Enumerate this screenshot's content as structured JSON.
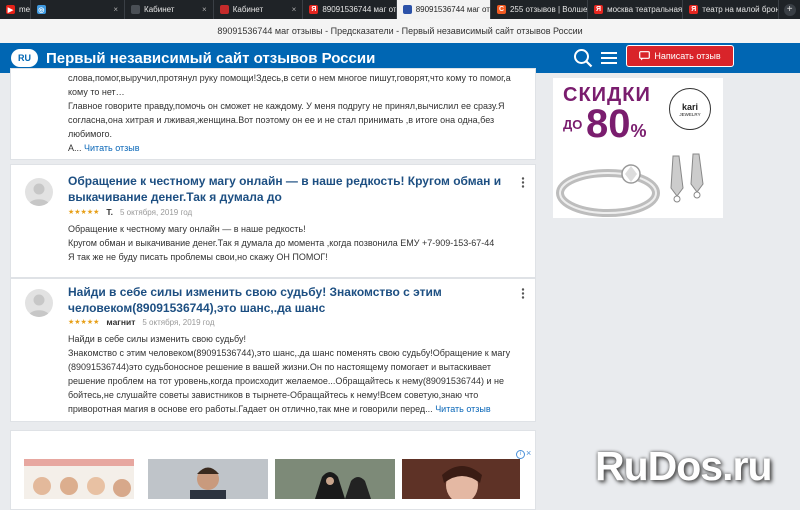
{
  "browser": {
    "tabs": [
      {
        "title": "me",
        "favicon": "youtube-icon",
        "color": "#e62117",
        "glyph": "▶",
        "active": false
      },
      {
        "title": "",
        "favicon": "opera-sync-icon",
        "color": "#3f9ae1",
        "glyph": "◎",
        "active": false
      },
      {
        "title": "Кабинет",
        "favicon": "site-icon",
        "color": "#4a4f55",
        "glyph": "",
        "active": false
      },
      {
        "title": "Кабинет",
        "favicon": "flag-icon",
        "color": "#c42b2b",
        "glyph": "",
        "active": false
      },
      {
        "title": "89091536744 маг отзы",
        "favicon": "yandex-icon",
        "color": "#e52620",
        "glyph": "Я",
        "active": false
      },
      {
        "title": "89091536744 маг от",
        "favicon": "flag-icon",
        "color": "#2b51a8",
        "glyph": "",
        "active": true
      },
      {
        "title": "255 отзывов | Волшеб",
        "favicon": "c-icon",
        "color": "#f15a22",
        "glyph": "C",
        "active": false
      },
      {
        "title": "москва театральная н",
        "favicon": "yandex-icon",
        "color": "#e52620",
        "glyph": "Я",
        "active": false
      },
      {
        "title": "театр на малой брон",
        "favicon": "yandex-icon",
        "color": "#e52620",
        "glyph": "Я",
        "active": false
      }
    ],
    "close_glyph": "×",
    "new_tab_glyph": "+",
    "page_title": "89091536744 маг отзывы - Предсказатели - Первый независимый сайт отзывов России"
  },
  "header": {
    "logo": "RU",
    "site_name": "Первый независимый сайт отзывов России",
    "write_review_label": "Написать отзыв"
  },
  "colors": {
    "header_bg": "#0066b3",
    "accent_red": "#d9242a",
    "link": "#0a67b8",
    "title": "#1d4f82",
    "stars": "#e7a019"
  },
  "reviews": [
    {
      "snippet": "слова,помог,выручил,протянул руку помощи!Здесь,в сети о нем многое пишут,говорят,что кому то помог,а кому то нет…\nГлавное говорите правду,помочь он сможет не каждому. У меня подругу не принял,вычислил ее сразу.Я согласна,она хитрая и лживая,женщина.Вот поэтому он ее и не стал принимать ,в итоге она одна,без любимого.\nА...",
      "more_label": "Читать отзыв"
    },
    {
      "title": "Обращение к честному магу онлайн — в наше редкость! Кругом обман и выкачивание денег.Так я думала до",
      "stars": "★★★★★",
      "author": "Т.",
      "date": "5 октября, 2019 год",
      "snippet": "Обращение к честному магу онлайн — в наше редкость!\nКругом обман и выкачивание денег.Так я думала до момента ,когда позвонила ЕМУ +7-909-153-67-44\nЯ так же не буду писать проблемы свои,но скажу ОН ПОМОГ!"
    },
    {
      "title": "Найди в себе силы изменить свою судьбу! Знакомство с этим человеком(89091536744),это шанс,.да шанс",
      "stars": "★★★★★",
      "author": "магнит",
      "date": "5 октября, 2019 год",
      "snippet": "Найди в себе силы изменить свою судьбу!\nЗнакомство с этим человеком(89091536744),это шанс,.да шанс поменять свою судьбу!Обращение к магу (89091536744)это судьбоносное решение в вашей жизни.Он по настоящему помогает и вытаскивает решение проблем на тот уровень,когда происходит желаемое...Обращайтесь к нему(89091536744) и не бойтесь,не слушайте советы завистников в тырнете-Обращайтесь к нему!Всем советую,знаю что приворотная магия в основе его работы.Гадает он отлично,так мне и говорили перед...",
      "more_label": "Читать отзыв"
    }
  ],
  "ad": {
    "line1": "СКИДКИ",
    "line2": "ДО",
    "percent": "80",
    "percent_sign": "%",
    "brand": "kari",
    "brand_sub": "JEWELRY"
  },
  "bottom_ads": {
    "info_glyph": "i",
    "close_glyph": "×"
  },
  "watermark": "RuDos.ru"
}
